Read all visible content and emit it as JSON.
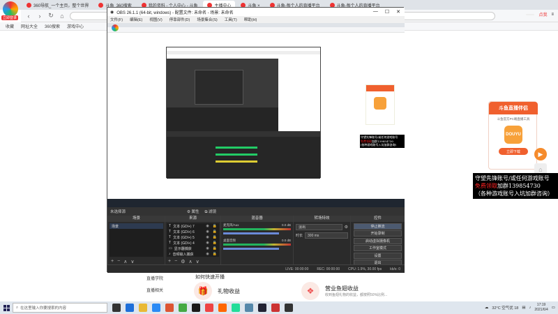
{
  "browser": {
    "logo_label": "立即登录",
    "tabs": [
      {
        "label": "360导航_一个主页，整个世界",
        "active": false
      },
      {
        "label": "斗鱼_360搜索",
        "active": false
      },
      {
        "label": "我的资料 - 个人中心 - 斗鱼",
        "active": false
      },
      {
        "label": "主播中心",
        "active": true
      },
      {
        "label": "斗鱼 ×",
        "active": false
      },
      {
        "label": "斗鱼-每个人的直播平台",
        "active": false
      },
      {
        "label": "斗鱼-每个人的直播平台",
        "active": false
      }
    ],
    "url": "",
    "user_label": "",
    "login_badge": "点我",
    "bookmarks": [
      "收藏",
      "网址大全",
      "360搜索",
      "游戏中心"
    ]
  },
  "page": {
    "side_nav": [
      "直播学院",
      "直播相关"
    ],
    "how_title": "如何快速开播",
    "features": [
      {
        "title": "礼物收益",
        "subtitle": ""
      },
      {
        "title": "营业鱼翅收益",
        "subtitle": "收到鱼翅礼物的收益，都按照50%比例..."
      }
    ],
    "promo": {
      "title": "斗鱼直播伴侣",
      "subtitle": "斗鱼官方PC端直播工具",
      "icon_text": "DOUYU",
      "button": "立即下载"
    },
    "overlay_ad": {
      "line1": "守望先锋账号/或任何游戏账号",
      "line2_red": "免费领取",
      "line2": "加群139854730",
      "line3": "（各种游戏账号入坑加群咨询）"
    }
  },
  "obs": {
    "title": "OBS 26.1.1 (64-bit, windows) - 配置文件: 未命名 - 场景: 未命名",
    "window_buttons": [
      "—",
      "☐",
      "✕"
    ],
    "menu": [
      "文件(F)",
      "编辑(E)",
      "视图(V)",
      "停靠部件(D)",
      "场景集合(S)",
      "工具(T)",
      "帮助(H)"
    ],
    "status_left": "未选择源",
    "status_props": "属性",
    "status_filters": "滤镜",
    "nested_ad": {
      "line1": "守望先锋账号/或任何游戏账号",
      "line2_red": "免费领取",
      "line2": "加群139854730",
      "line3": "(各种游戏账号入坑加群咨询)"
    },
    "docks": {
      "scenes": {
        "header": "场景",
        "items": [
          "场景"
        ]
      },
      "sources": {
        "header": "来源",
        "items": [
          "文本 (GDI+) 7",
          "文本 (GDI+) 6",
          "文本 (GDI+) 5",
          "文本 (GDI+) 4",
          "显示器捕获",
          "音频输入捕获"
        ]
      },
      "mixer": {
        "header": "混音器",
        "channels": [
          {
            "name": "麦克风/Aux",
            "db": "0.0 dB"
          },
          {
            "name": "桌面音频",
            "db": "0.0 dB"
          }
        ]
      },
      "transitions": {
        "header": "转场特效",
        "type": "淡出",
        "duration_label": "时长",
        "duration": "300 ms"
      },
      "controls": {
        "header": "控件",
        "buttons": [
          "停止推流",
          "开始录制",
          "启动虚拟摄像机",
          "工作室模式",
          "设置",
          "退出"
        ]
      }
    },
    "footer": {
      "live": "LIVE: 00:00:00",
      "rec": "REC: 00:00:00",
      "cpu": "CPU: 1.9%, 30.00 fps",
      "kbps": "kb/s: 0"
    }
  },
  "taskbar": {
    "search_placeholder": "在这里输入你要搜索的内容",
    "weather": "32°C 空气优 18",
    "time": "17:19",
    "date": "2021/6/4"
  }
}
